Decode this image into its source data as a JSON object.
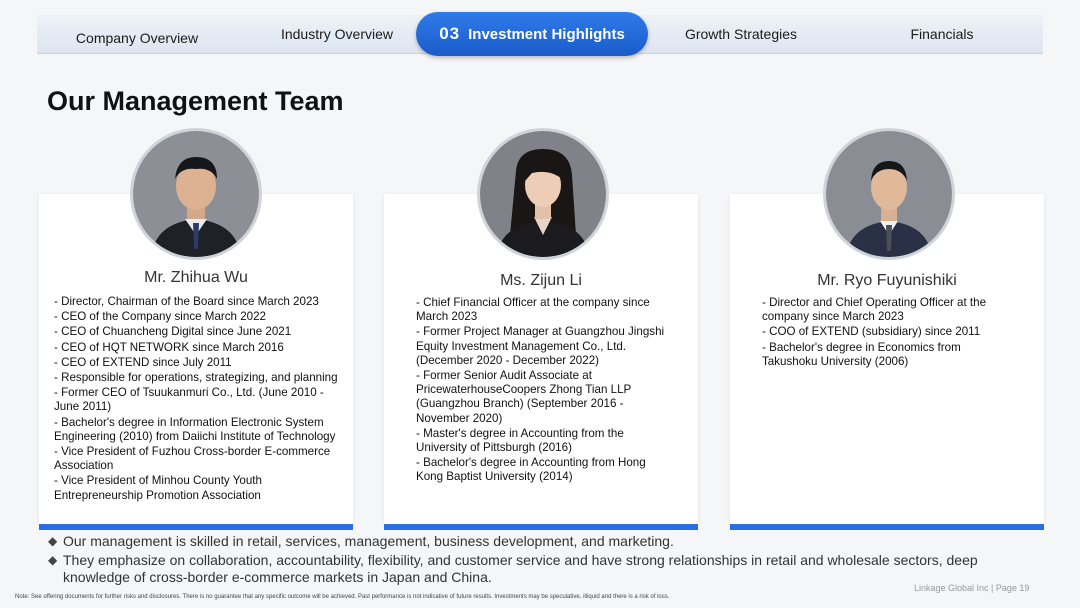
{
  "nav": {
    "tabs": [
      {
        "label": "Company Overview"
      },
      {
        "label": "Industry Overview"
      },
      {
        "num": "03",
        "label": "Investment Highlights"
      },
      {
        "label": "Growth Strategies"
      },
      {
        "label": "Financials"
      }
    ]
  },
  "page_title": "Our Management Team",
  "team": [
    {
      "name": "Mr. Zhihua Wu",
      "bio": [
        "- Director, Chairman of the Board since March 2023",
        "- CEO of the Company since March 2022",
        "- CEO of Chuancheng Digital since June 2021",
        "- CEO of HQT NETWORK since March 2016",
        "- CEO of EXTEND since July 2011",
        "- Responsible for operations, strategizing, and planning",
        "- Former CEO of Tsuukanmuri Co., Ltd. (June 2010 - June 2011)",
        "- Bachelor's degree in Information Electronic System Engineering (2010) from Daiichi Institute of Technology",
        "- Vice President of Fuzhou Cross-border E-commerce Association",
        "- Vice President of Minhou County Youth Entrepreneurship Promotion Association"
      ]
    },
    {
      "name": "Ms. Zijun Li",
      "bio": [
        "- Chief Financial Officer at the company since March 2023",
        "- Former Project Manager at Guangzhou Jingshi Equity Investment Management Co., Ltd. (December 2020 - December 2022)",
        "- Former Senior Audit Associate at PricewaterhouseCoopers Zhong Tian LLP (Guangzhou Branch) (September 2016 - November 2020)",
        "- Master's degree in Accounting from the University of Pittsburgh (2016)",
        "- Bachelor's degree in Accounting from Hong Kong Baptist University (2014)"
      ]
    },
    {
      "name": "Mr. Ryo Fuyunishiki",
      "bio": [
        "- Director and Chief Operating Officer at the company since March 2023",
        "- COO of EXTEND (subsidiary) since 2011",
        "- Bachelor's degree in Economics from Takushoku University (2006)"
      ]
    }
  ],
  "summary": [
    "Our management is skilled in retail, services, management, business development, and marketing.",
    "They emphasize on collaboration, accountability, flexibility, and customer service and have strong relationships in retail and wholesale sectors, deep knowledge of cross-border e-commerce markets in Japan and China."
  ],
  "bullet_glyph": "◆",
  "footer": {
    "note": "Note: See offering documents for further risks and disclosures. There is no guarantee that any specific outcome will be achieved. Past performance is not indicative of future results. Investments may be speculative, illiquid and there is a risk of loss.",
    "page": "Linkage Global Inc | Page 19"
  },
  "colors": {
    "accent": "#2a6fe0",
    "nav_active": "#1a5cc8"
  }
}
